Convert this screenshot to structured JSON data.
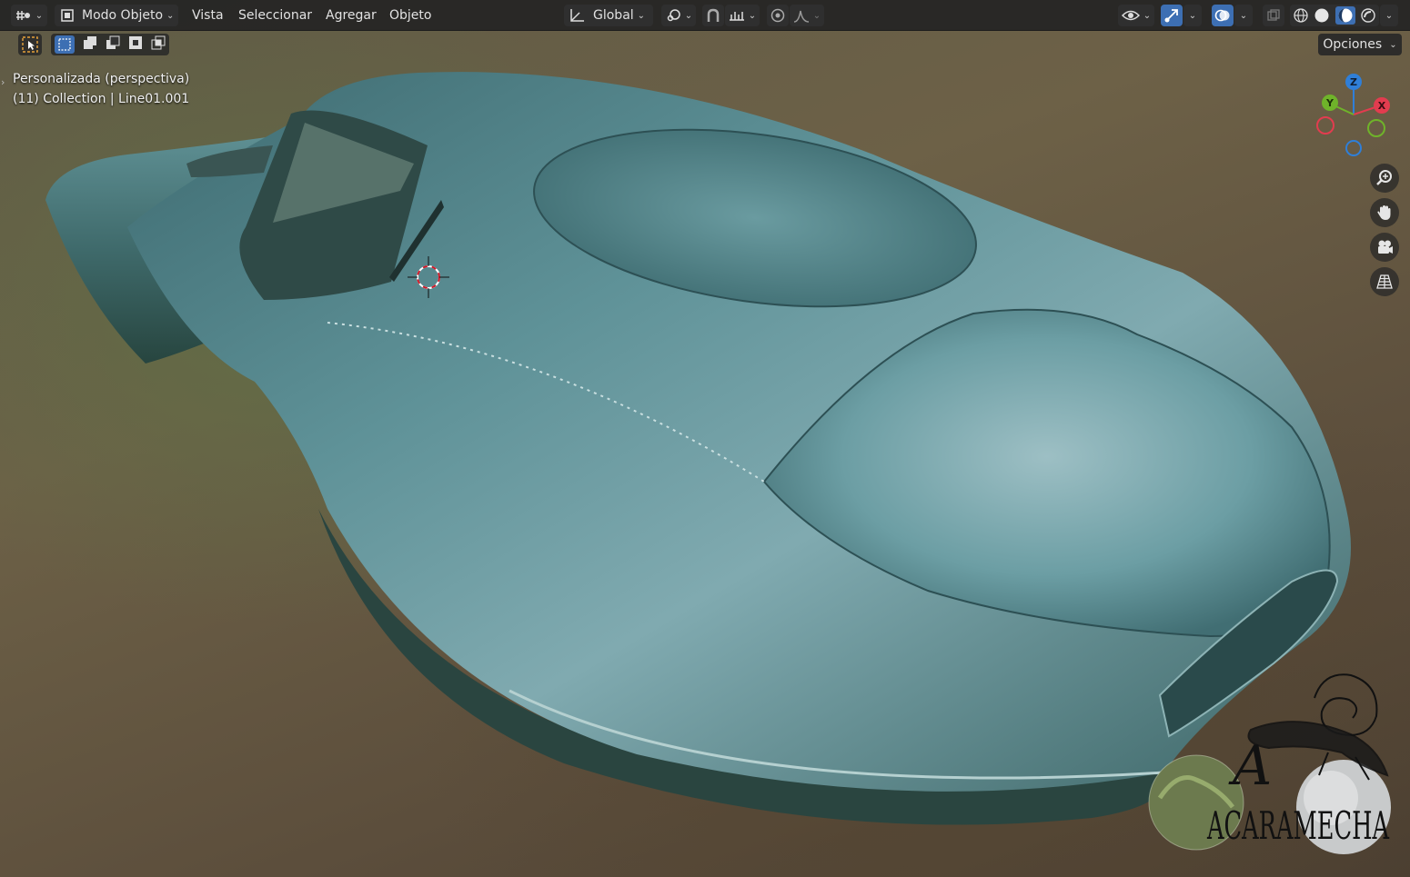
{
  "header": {
    "mode_label": "Modo Objeto",
    "menus": [
      "Vista",
      "Seleccionar",
      "Agregar",
      "Objeto"
    ],
    "transform_orientation": "Global",
    "options_label": "Opciones"
  },
  "overlay": {
    "view_name": "Personalizada (perspectiva)",
    "collection_info": "(11) Collection | Line01.001"
  },
  "gizmo": {
    "axis_x": "X",
    "axis_y": "Y",
    "axis_z": "Z",
    "colors": {
      "x": "#e23c4f",
      "y": "#6fb32a",
      "z": "#2f7fd8"
    }
  },
  "watermark": {
    "text": "ACARAMECHA"
  },
  "icons": {
    "editor_type": "editor-type-icon",
    "mode": "object-mode-icon",
    "orientation": "transform-orientation-icon",
    "pivot": "pivot-icon",
    "snap": "snap-magnet-icon",
    "snap_increment": "snap-increment-icon",
    "proportional": "proportional-edit-icon",
    "falloff": "falloff-curve-icon",
    "visibility": "eye-visibility-icon",
    "gizmo_toggle": "gizmo-toggle-icon",
    "overlay_toggle": "overlay-toggle-icon",
    "xray": "xray-icon",
    "shading_wire": "wireframe-shading-icon",
    "shading_solid": "solid-shading-icon",
    "shading_material": "material-shading-icon",
    "shading_rendered": "rendered-shading-icon",
    "zoom": "zoom-icon",
    "pan": "hand-pan-icon",
    "camera": "camera-icon",
    "grid": "grid-perspective-icon"
  },
  "colors": {
    "accent_blue": "#3d6fb3",
    "header_bg": "#242424",
    "car_body": "#4a7f86"
  }
}
